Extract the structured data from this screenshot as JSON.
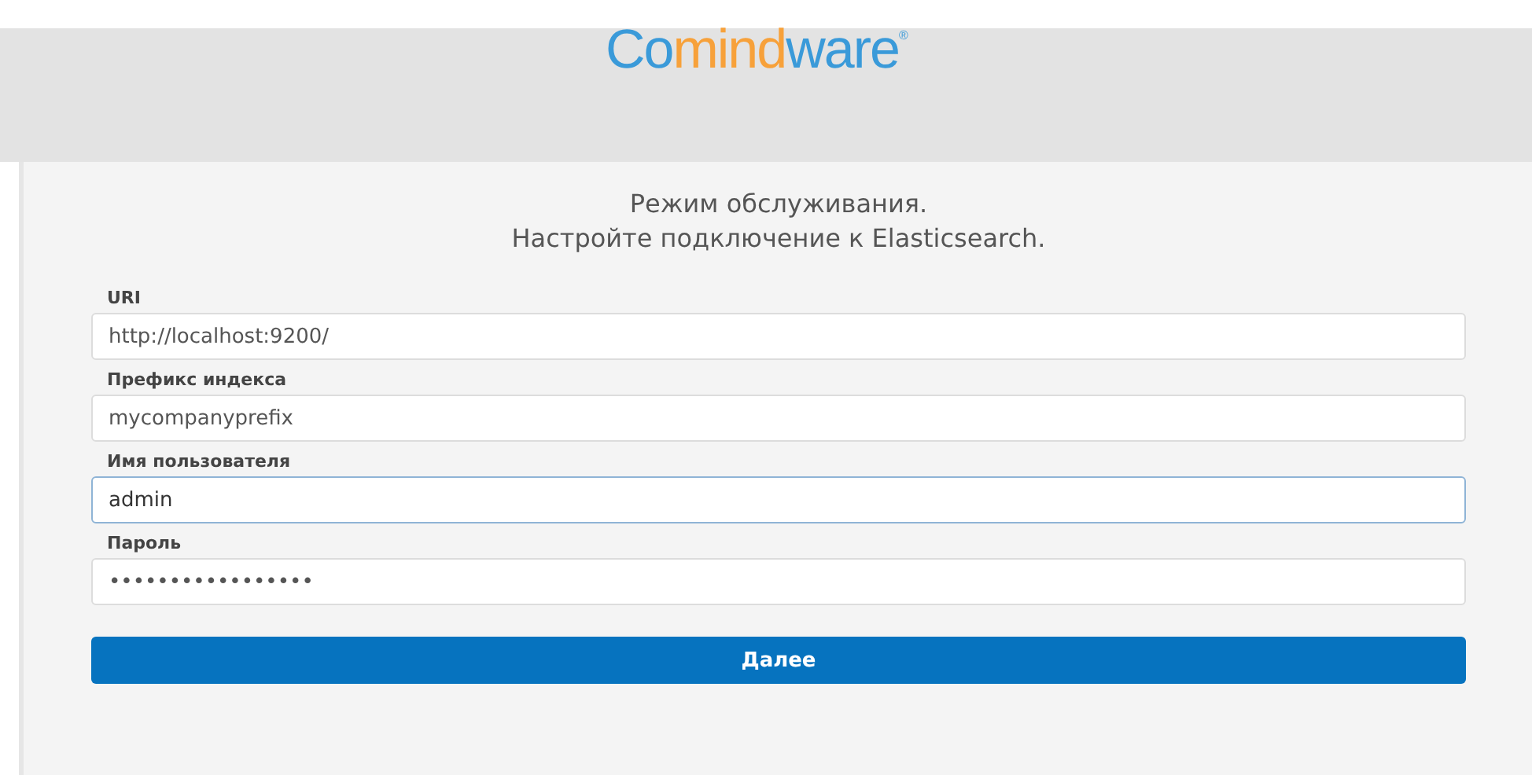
{
  "logo": {
    "parts": [
      {
        "text": "Co",
        "color": "#3a9ad9"
      },
      {
        "text": "mind",
        "color": "#f7a13a"
      },
      {
        "text": "ware",
        "color": "#3a9ad9"
      }
    ],
    "mark": "®"
  },
  "heading": [
    "Режим обслуживания.",
    "Настройте подключение к Elasticsearch."
  ],
  "fields": [
    {
      "label": "URI",
      "value": "http://localhost:9200/",
      "focused": false
    },
    {
      "label": "Префикс индекса",
      "value": "mycompanyprefix",
      "focused": false
    },
    {
      "label": "Имя пользователя",
      "value": "admin",
      "focused": true
    },
    {
      "label": "Пароль",
      "value": "•••••••••••••••••",
      "focused": false
    }
  ],
  "button": "Далее"
}
